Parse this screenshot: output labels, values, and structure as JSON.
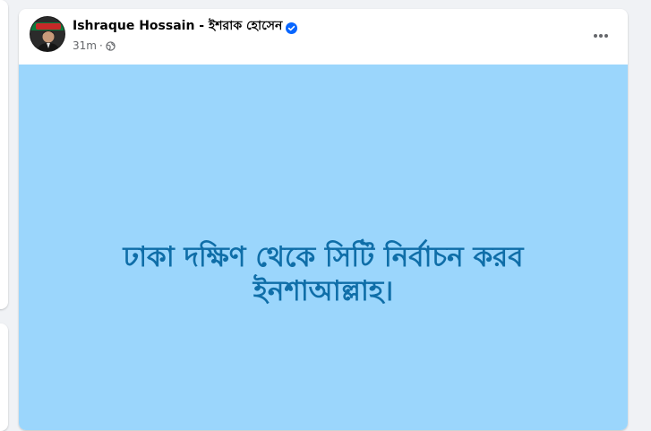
{
  "post": {
    "author_name": "Ishraque Hossain - ইশরাক হোসেন",
    "timestamp": "31m",
    "separator": "·",
    "verified_icon": "verified-badge-icon",
    "privacy_icon": "globe-icon",
    "more_icon": "more-options-icon",
    "avatar_badge_text": "বাংলাদেশ",
    "background_color": "#9bd6fc",
    "text_color": "#0f6ea8",
    "body_lines": [
      "ঢাকা দক্ষিণ থেকে সিটি নির্বাচন করব",
      "ইনশাআল্লাহ।"
    ]
  }
}
